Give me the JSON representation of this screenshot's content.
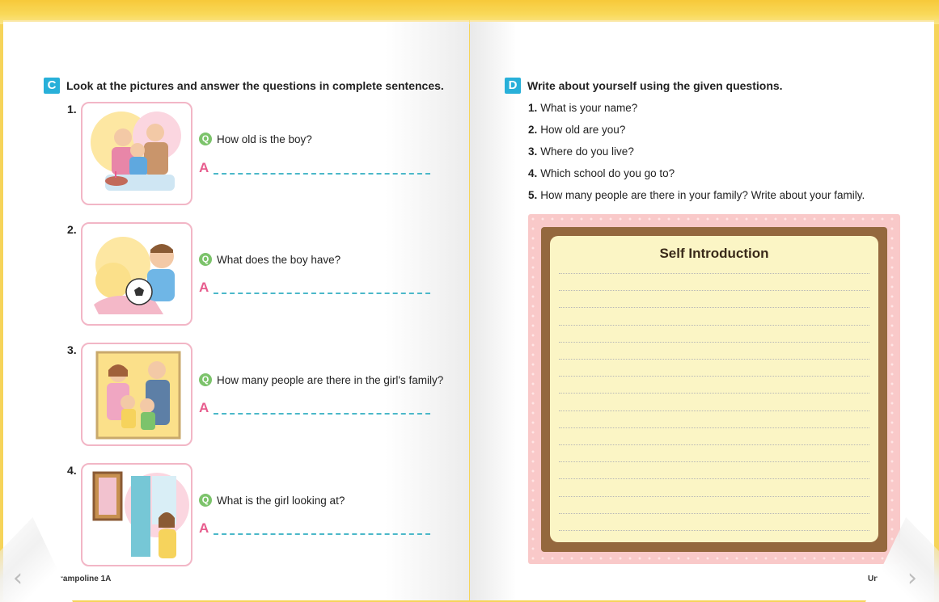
{
  "left_page": {
    "section_badge": "C",
    "section_title": "Look at the pictures and answer the questions in complete sentences.",
    "questions": [
      {
        "num": "1.",
        "q_icon": "Q",
        "question": "How old is the boy?",
        "a_icon": "A",
        "picture": "birthday-family-illustration"
      },
      {
        "num": "2.",
        "q_icon": "Q",
        "question": "What does the boy have?",
        "a_icon": "A",
        "picture": "boy-with-soccer-ball-illustration"
      },
      {
        "num": "3.",
        "q_icon": "Q",
        "question": "How many people are there in the girl's family?",
        "a_icon": "A",
        "picture": "family-portrait-illustration"
      },
      {
        "num": "4.",
        "q_icon": "Q",
        "question": "What is the girl looking at?",
        "a_icon": "A",
        "picture": "girl-looking-at-painting-illustration"
      }
    ],
    "footer": "rampoline 1A"
  },
  "right_page": {
    "section_badge": "D",
    "section_title": "Write about yourself using the given questions.",
    "items": [
      {
        "num": "1.",
        "text": "What is your name?"
      },
      {
        "num": "2.",
        "text": "How old are you?"
      },
      {
        "num": "3.",
        "text": "Where do you live?"
      },
      {
        "num": "4.",
        "text": "Which school do you go to?"
      },
      {
        "num": "5.",
        "text": "How many people are there in your family? Write about your family."
      }
    ],
    "note_title": "Self Introduction",
    "footer": "Un"
  },
  "nav": {
    "prev_icon": "‹",
    "next_icon": "›"
  },
  "colors": {
    "accent_badge": "#28b0d9",
    "q_icon": "#7cc36b",
    "a_icon": "#e75c8d",
    "answer_rule": "#4bb8c9",
    "frame_brown": "#94683e",
    "frame_pink": "#f9c9c9",
    "note_bg": "#fbf5c5",
    "top_bar": "#f7c93a"
  }
}
